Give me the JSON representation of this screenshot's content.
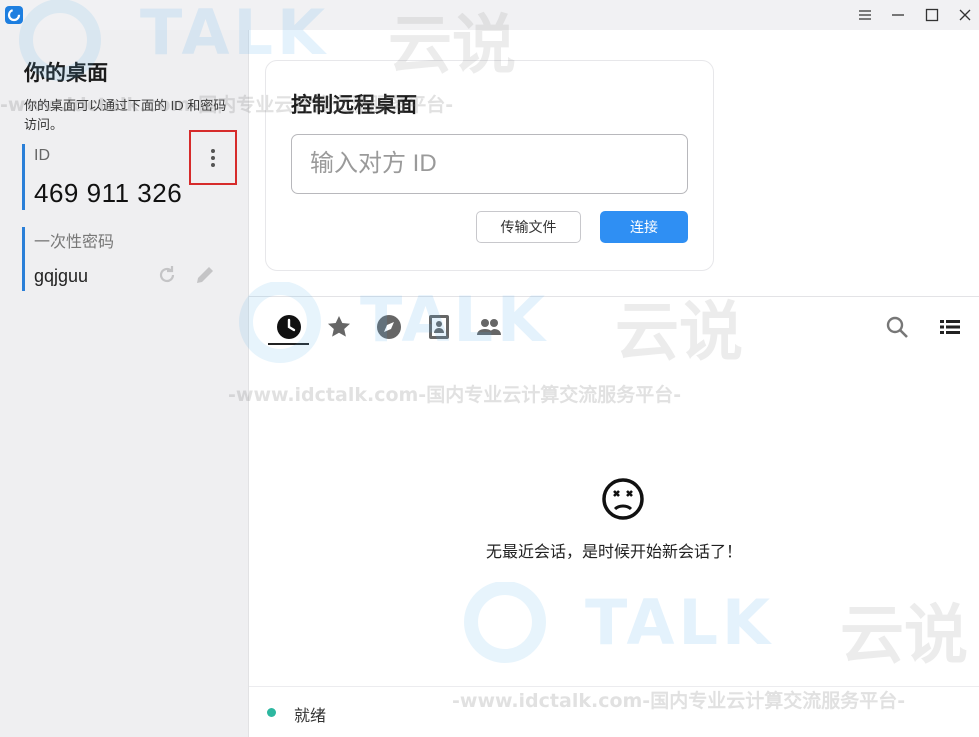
{
  "window": {
    "menu_icon": "hamburger-icon",
    "minimize_icon": "minimize-icon",
    "maximize_icon": "maximize-icon",
    "close_icon": "close-icon"
  },
  "sidebar": {
    "title": "你的桌面",
    "description": "你的桌面可以通过下面的 ID 和密码访问。",
    "id_label": "ID",
    "id_value": "469 911 326",
    "password_label": "一次性密码",
    "password_value": "gqjguu"
  },
  "control": {
    "title": "控制远程桌面",
    "input_placeholder": "输入对方 ID",
    "input_value": "",
    "transfer_button": "传输文件",
    "connect_button": "连接"
  },
  "tabs": [
    {
      "name": "recent",
      "icon": "clock-icon",
      "active": true
    },
    {
      "name": "favorites",
      "icon": "star-icon",
      "active": false
    },
    {
      "name": "discovered",
      "icon": "compass-icon",
      "active": false
    },
    {
      "name": "address-book",
      "icon": "contacts-icon",
      "active": false
    },
    {
      "name": "group",
      "icon": "people-icon",
      "active": false
    }
  ],
  "empty_state": {
    "icon": "sad-face-icon",
    "message": "无最近会话，是时候开始新会话了！"
  },
  "status": {
    "text": "就绪",
    "color": "#2db7a0"
  },
  "watermark": {
    "brand": "TALK",
    "brand_cn": "云说",
    "url": "-www.idctalk.com-国内专业云计算交流服务平台-"
  },
  "colors": {
    "accent": "#2f8ff3",
    "sidebar_bg": "#efeff1",
    "highlight_box": "#d62b2b"
  }
}
